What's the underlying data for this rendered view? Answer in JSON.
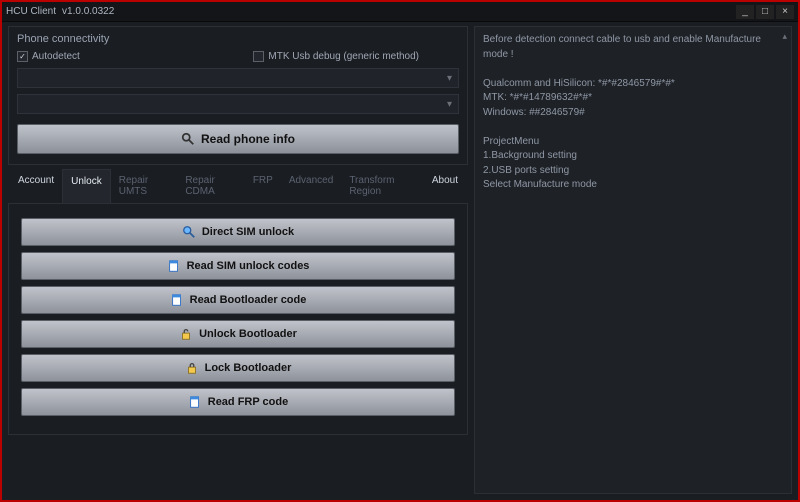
{
  "window": {
    "title": "HCU Client",
    "version": "v1.0.0.0322"
  },
  "connectivity": {
    "title": "Phone connectivity",
    "autodetect_label": "Autodetect",
    "autodetect_checked": true,
    "mtk_debug_label": "MTK Usb debug (generic method)",
    "mtk_debug_checked": false,
    "read_phone_info": "Read phone info"
  },
  "tabs": {
    "items": [
      {
        "label": "Account",
        "state": "bright"
      },
      {
        "label": "Unlock",
        "state": "active"
      },
      {
        "label": "Repair UMTS",
        "state": "dim"
      },
      {
        "label": "Repair CDMA",
        "state": "dim"
      },
      {
        "label": "FRP",
        "state": "dim"
      },
      {
        "label": "Advanced",
        "state": "dim"
      },
      {
        "label": "Transform Region",
        "state": "dim"
      },
      {
        "label": "About",
        "state": "bright"
      }
    ]
  },
  "actions": [
    {
      "icon": "search-icon",
      "label": "Direct SIM unlock"
    },
    {
      "icon": "page-icon",
      "label": "Read SIM unlock codes"
    },
    {
      "icon": "page-icon",
      "label": "Read Bootloader code"
    },
    {
      "icon": "unlock-icon",
      "label": "Unlock Bootloader"
    },
    {
      "icon": "lock-icon",
      "label": "Lock Bootloader"
    },
    {
      "icon": "page-icon",
      "label": "Read FRP code"
    }
  ],
  "log": {
    "lines": [
      "Before detection connect cable to usb and enable Manufacture mode !",
      "",
      "Qualcomm and HiSilicon: *#*#2846579#*#*",
      "MTK: *#*#14789632#*#*",
      "Windows: ##2846579#",
      "",
      "ProjectMenu",
      "1.Background setting",
      "2.USB ports setting",
      "Select Manufacture mode"
    ]
  }
}
